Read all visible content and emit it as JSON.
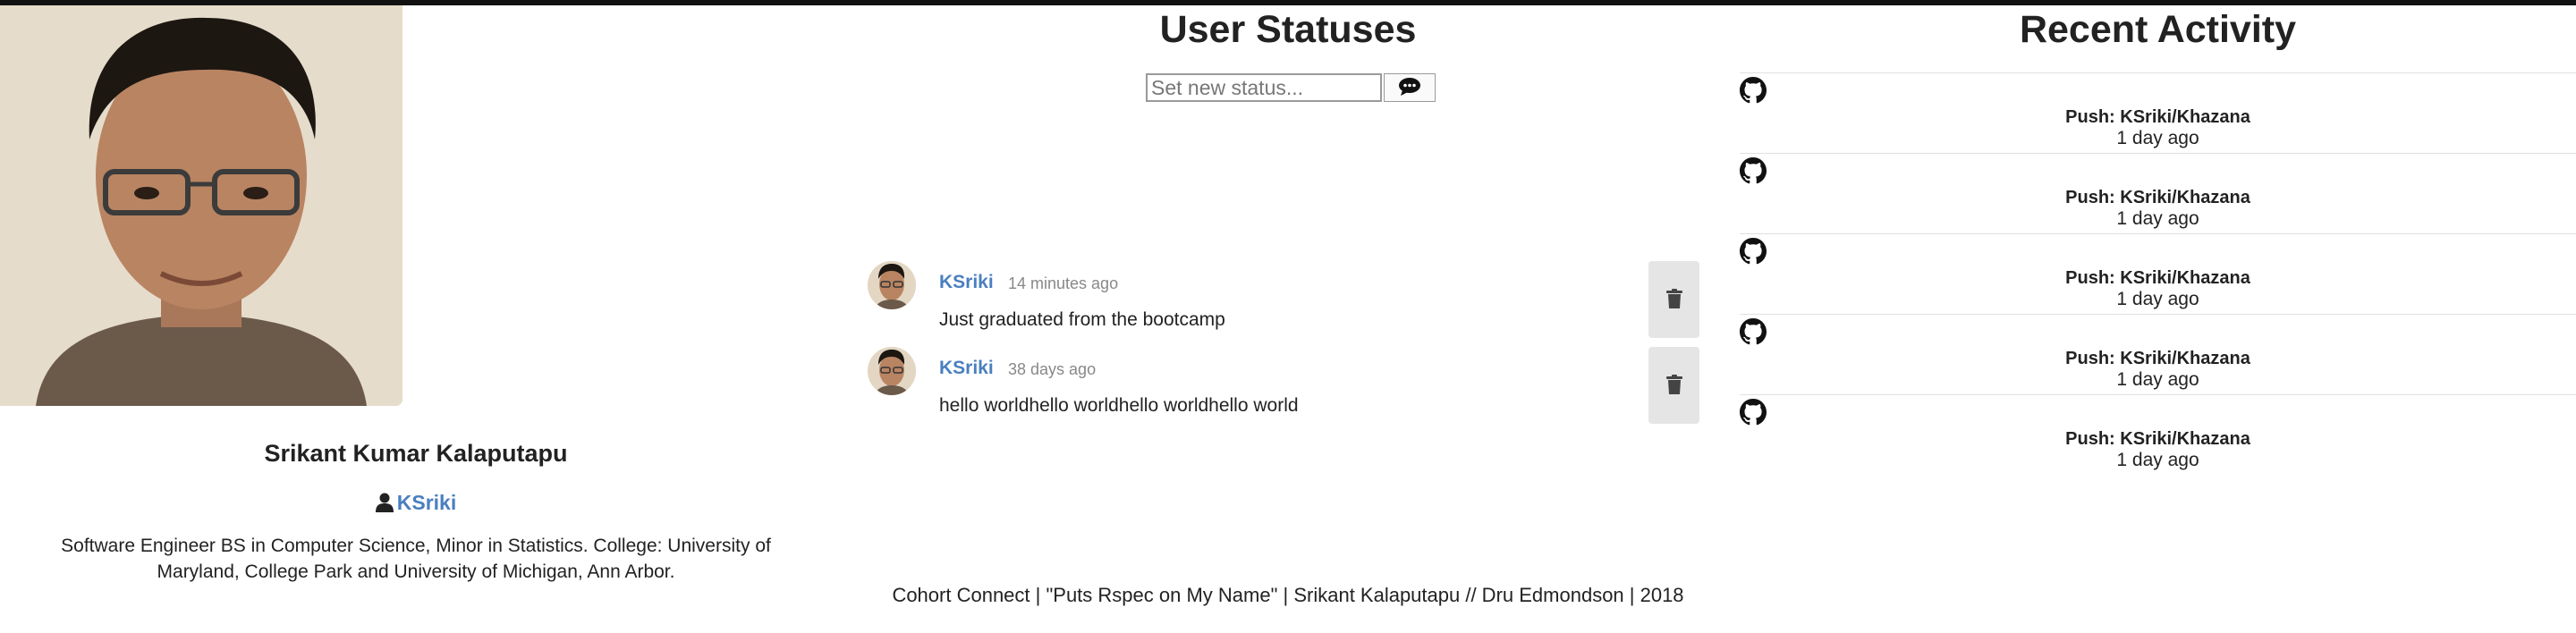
{
  "profile": {
    "name": "Srikant Kumar Kalaputapu",
    "username": "KSriki",
    "bio": "Software Engineer BS in Computer Science, Minor in Statistics.  College: University of Maryland, College Park and University of Michigan, Ann Arbor."
  },
  "statuses": {
    "title": "User Statuses",
    "input_placeholder": "Set new status...",
    "items": [
      {
        "author": "KSriki",
        "time": "14 minutes ago",
        "text": "Just graduated from the bootcamp"
      },
      {
        "author": "KSriki",
        "time": "38 days ago",
        "text": "hello worldhello worldhello worldhello world"
      }
    ]
  },
  "activity": {
    "title": "Recent Activity",
    "items": [
      {
        "event": "Push: KSriki/Khazana",
        "time": "1 day ago"
      },
      {
        "event": "Push: KSriki/Khazana",
        "time": "1 day ago"
      },
      {
        "event": "Push: KSriki/Khazana",
        "time": "1 day ago"
      },
      {
        "event": "Push: KSriki/Khazana",
        "time": "1 day ago"
      },
      {
        "event": "Push: KSriki/Khazana",
        "time": "1 day ago"
      }
    ]
  },
  "footer": {
    "text": "Cohort Connect | \"Puts Rspec on My Name\" | Srikant Kalaputapu // Dru Edmondson | 2018"
  },
  "colors": {
    "link": "#4a7fbf",
    "delete_button_bg": "#e5e5e5",
    "top_bar": "#111111"
  },
  "icons": [
    "user-icon",
    "comment-icon",
    "trash-icon",
    "github-icon"
  ]
}
